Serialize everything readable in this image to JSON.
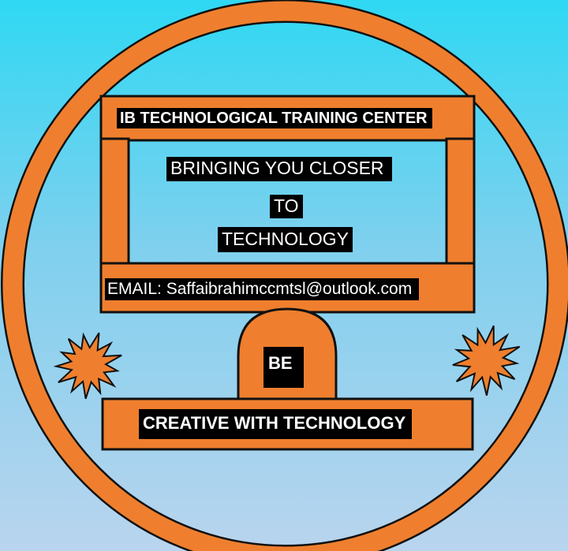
{
  "logo": {
    "center_name": "IB TECHNOLOGICAL TRAINING CENTER",
    "slogan_line1": "BRINGING YOU CLOSER",
    "slogan_line2": "TO",
    "slogan_line3": "TECHNOLOGY",
    "email": "EMAIL: Saffaibrahimccmtsl@outlook.com",
    "be": "BE",
    "tagline": "CREATIVE WITH TECHNOLOGY"
  },
  "colors": {
    "orange": "#ef7f2e",
    "outline": "#111111",
    "label_bg": "#000000",
    "label_text": "#ffffff",
    "sky_top": "#2fd8f3",
    "sky_bottom": "#b9d4ee"
  }
}
